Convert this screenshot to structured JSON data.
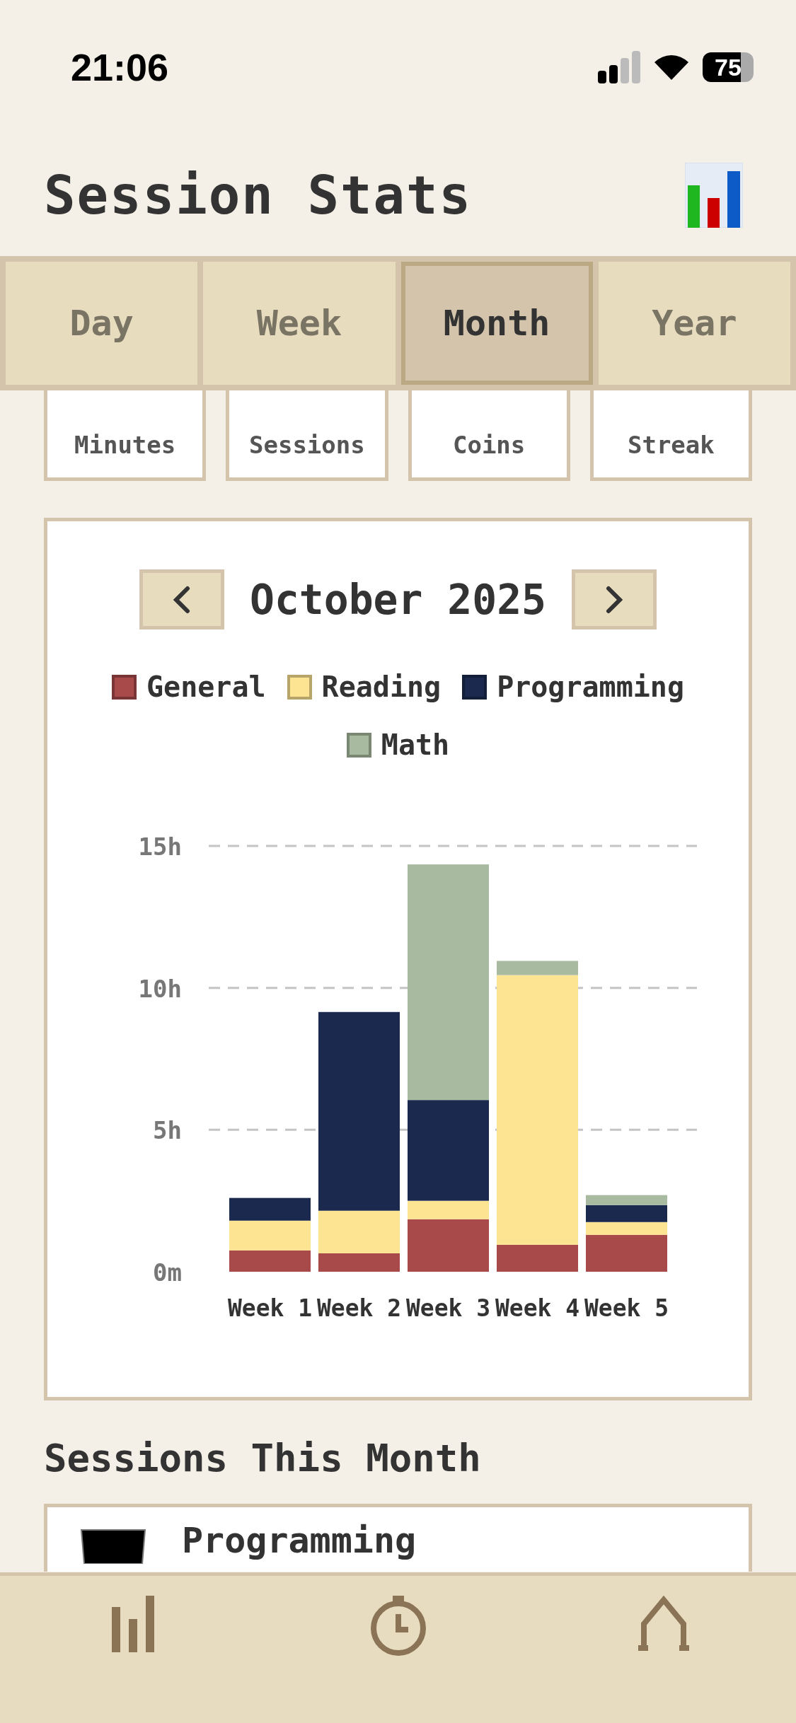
{
  "status_bar": {
    "time": "21:06",
    "battery": "75"
  },
  "header": {
    "title": "Session Stats"
  },
  "tabs": [
    {
      "label": "Day",
      "selected": false
    },
    {
      "label": "Week",
      "selected": false
    },
    {
      "label": "Month",
      "selected": true
    },
    {
      "label": "Year",
      "selected": false
    }
  ],
  "stats": [
    {
      "label": "Minutes"
    },
    {
      "label": "Sessions"
    },
    {
      "label": "Coins"
    },
    {
      "label": "Streak"
    }
  ],
  "chart_card": {
    "month": "October 2025",
    "chart_data": {
      "type": "bar",
      "stacked": true,
      "categories": [
        "Week 1",
        "Week 2",
        "Week 3",
        "Week 4",
        "Week 5"
      ],
      "ylim": [
        0,
        15
      ],
      "yticks": [
        {
          "value": 0,
          "label": "0m"
        },
        {
          "value": 5,
          "label": "5h"
        },
        {
          "value": 10,
          "label": "10h"
        },
        {
          "value": 15,
          "label": "15h"
        }
      ],
      "series": [
        {
          "name": "General",
          "color": "#a84a4a",
          "values": [
            0.75,
            0.65,
            1.85,
            0.95,
            1.3
          ]
        },
        {
          "name": "Reading",
          "color": "#fde492",
          "values": [
            1.05,
            1.5,
            0.65,
            9.5,
            0.45
          ]
        },
        {
          "name": "Programming",
          "color": "#1b294f",
          "values": [
            0.8,
            7.0,
            3.55,
            0,
            0.6
          ]
        },
        {
          "name": "Math",
          "color": "#a8bba0",
          "values": [
            0,
            0,
            8.3,
            0.5,
            0.35
          ]
        }
      ]
    }
  },
  "sessions": {
    "heading": "Sessions This Month",
    "items": [
      {
        "title": "Programming"
      }
    ]
  },
  "bottom_nav": {
    "items": [
      {
        "kind": "stats"
      },
      {
        "kind": "timer"
      },
      {
        "kind": "home"
      }
    ]
  }
}
